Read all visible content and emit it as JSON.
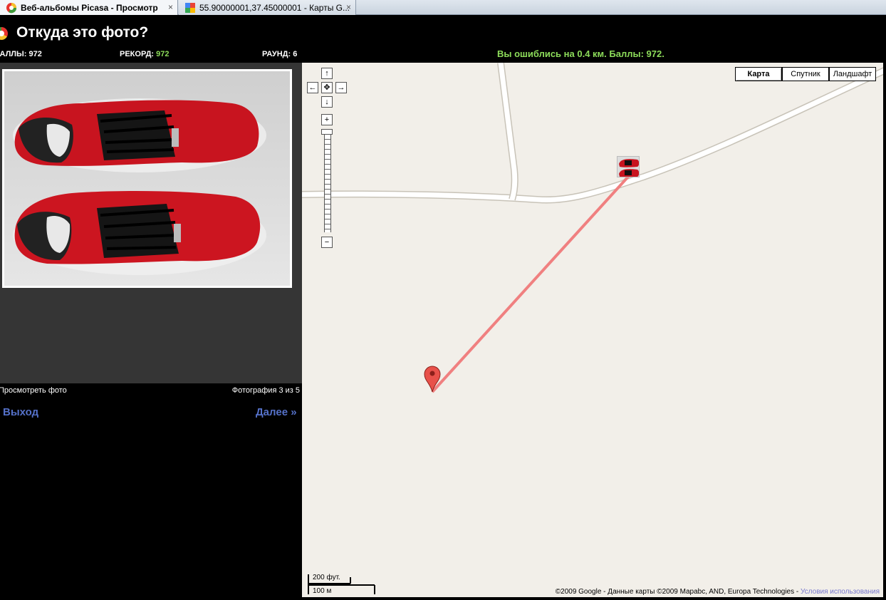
{
  "tabs": [
    {
      "label": "Веб-альбомы Picasa - Просмотр",
      "close": "×",
      "icon": "picasa-icon",
      "active": true
    },
    {
      "label": "55.90000001,37.45000001 - Карты G...",
      "close": "×",
      "icon": "google-maps-icon",
      "active": false
    }
  ],
  "header": {
    "title": "Откуда это фото?"
  },
  "stats": {
    "score_label": "БАЛЛЫ:",
    "score_value": "972",
    "record_label": "РЕКОРД:",
    "record_value": "972",
    "round_label": "РАУНД:",
    "round_value": "6"
  },
  "result": {
    "message": "Вы ошиблись на 0.4 км. Баллы: 972."
  },
  "photo": {
    "caption": "Просмотреть фото",
    "counter": "Фотография 3 из 5",
    "subject": "red sneakers photo"
  },
  "nav": {
    "exit_label": "Выход",
    "next_label": "Далее »"
  },
  "map": {
    "types": [
      "Карта",
      "Спутник",
      "Ландшафт"
    ],
    "selected_type": "Карта",
    "pan": {
      "up": "↑",
      "down": "↓",
      "left": "←",
      "right": "→",
      "center": "✥"
    },
    "zoom_in": "+",
    "zoom_out": "−",
    "scale_ft": "200 фут.",
    "scale_m": "100 м",
    "copyright": "©2009 Google - Данные карты ©2009 Mapabc, AND, Europa Technologies - ",
    "terms": "Условия использования"
  },
  "colors": {
    "accent_green": "#8ddc5a",
    "link_blue": "#5571c9",
    "map_bg": "#f2efe9",
    "error_line": "#f08080",
    "marker_red": "#e8514a"
  }
}
